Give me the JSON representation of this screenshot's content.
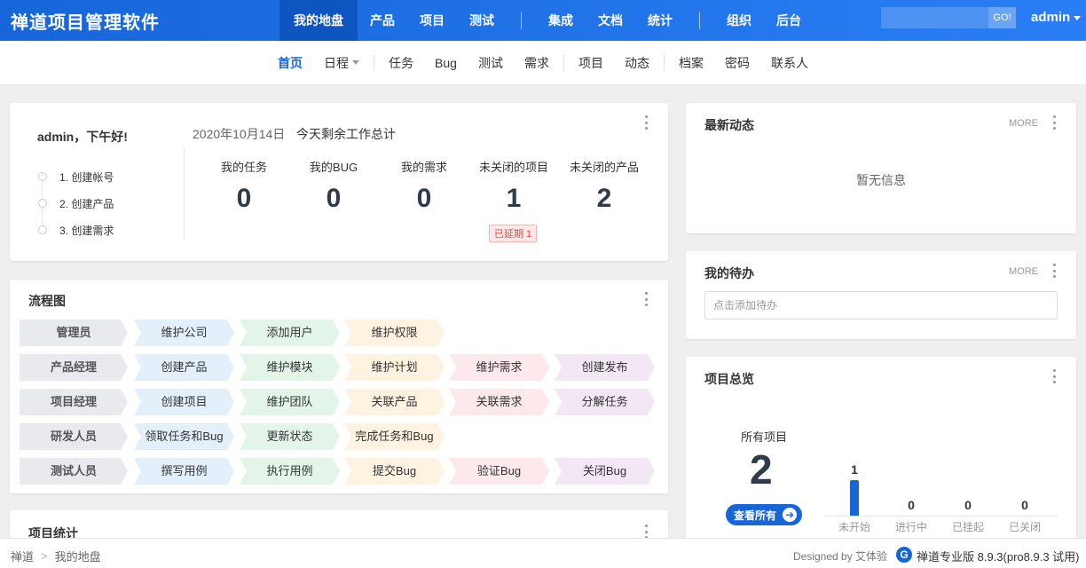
{
  "header": {
    "brand": "禅道项目管理软件",
    "nav": [
      "我的地盘",
      "产品",
      "项目",
      "测试",
      "集成",
      "文档",
      "统计",
      "组织",
      "后台"
    ],
    "search_go": "GO!",
    "user": "admin"
  },
  "subnav": [
    "首页",
    "日程",
    "任务",
    "Bug",
    "测试",
    "需求",
    "项目",
    "动态",
    "档案",
    "密码",
    "联系人"
  ],
  "welcome": {
    "greeting": "admin，下午好!",
    "steps": [
      "1. 创建帐号",
      "2. 创建产品",
      "3. 创建需求"
    ],
    "date": "2020年10月14日",
    "today_title": "今天剩余工作总计",
    "stats": [
      {
        "label": "我的任务",
        "value": "0"
      },
      {
        "label": "我的BUG",
        "value": "0"
      },
      {
        "label": "我的需求",
        "value": "0"
      },
      {
        "label": "未关闭的项目",
        "value": "1"
      },
      {
        "label": "未关闭的产品",
        "value": "2"
      }
    ],
    "delayed_badge": "已延期 1"
  },
  "flow": {
    "title": "流程图",
    "rows": [
      {
        "role": "管理员",
        "steps": [
          "维护公司",
          "添加用户",
          "维护权限"
        ]
      },
      {
        "role": "产品经理",
        "steps": [
          "创建产品",
          "维护模块",
          "维护计划",
          "维护需求",
          "创建发布"
        ]
      },
      {
        "role": "项目经理",
        "steps": [
          "创建项目",
          "维护团队",
          "关联产品",
          "关联需求",
          "分解任务"
        ]
      },
      {
        "role": "研发人员",
        "steps": [
          "领取任务和Bug",
          "更新状态",
          "完成任务和Bug"
        ]
      },
      {
        "role": "测试人员",
        "steps": [
          "撰写用例",
          "执行用例",
          "提交Bug",
          "验证Bug",
          "关闭Bug"
        ]
      }
    ],
    "colors": [
      "#e3f0fc",
      "#e3f5e8",
      "#fdf3e0",
      "#fde8ec",
      "#f3e6f5"
    ],
    "role_color": "#e8eaed"
  },
  "project_stats": {
    "title": "项目统计"
  },
  "dynamics": {
    "title": "最新动态",
    "more": "MORE",
    "empty": "暂无信息"
  },
  "todo": {
    "title": "我的待办",
    "more": "MORE",
    "placeholder": "点击添加待办"
  },
  "overview": {
    "title": "项目总览",
    "all_label": "所有项目",
    "all_count": "2",
    "view_all": "查看所有",
    "chart_data": {
      "type": "bar",
      "categories": [
        "未开始",
        "进行中",
        "已挂起",
        "已关闭"
      ],
      "values": [
        1,
        0,
        0,
        0
      ]
    }
  },
  "footer": {
    "breadcrumb": [
      "禅道",
      "我的地盘"
    ],
    "designed_by": "Designed by 艾体验",
    "version": "禅道专业版 8.9.3(pro8.9.3 试用)"
  },
  "colors": {
    "accent": "#1766d9"
  }
}
